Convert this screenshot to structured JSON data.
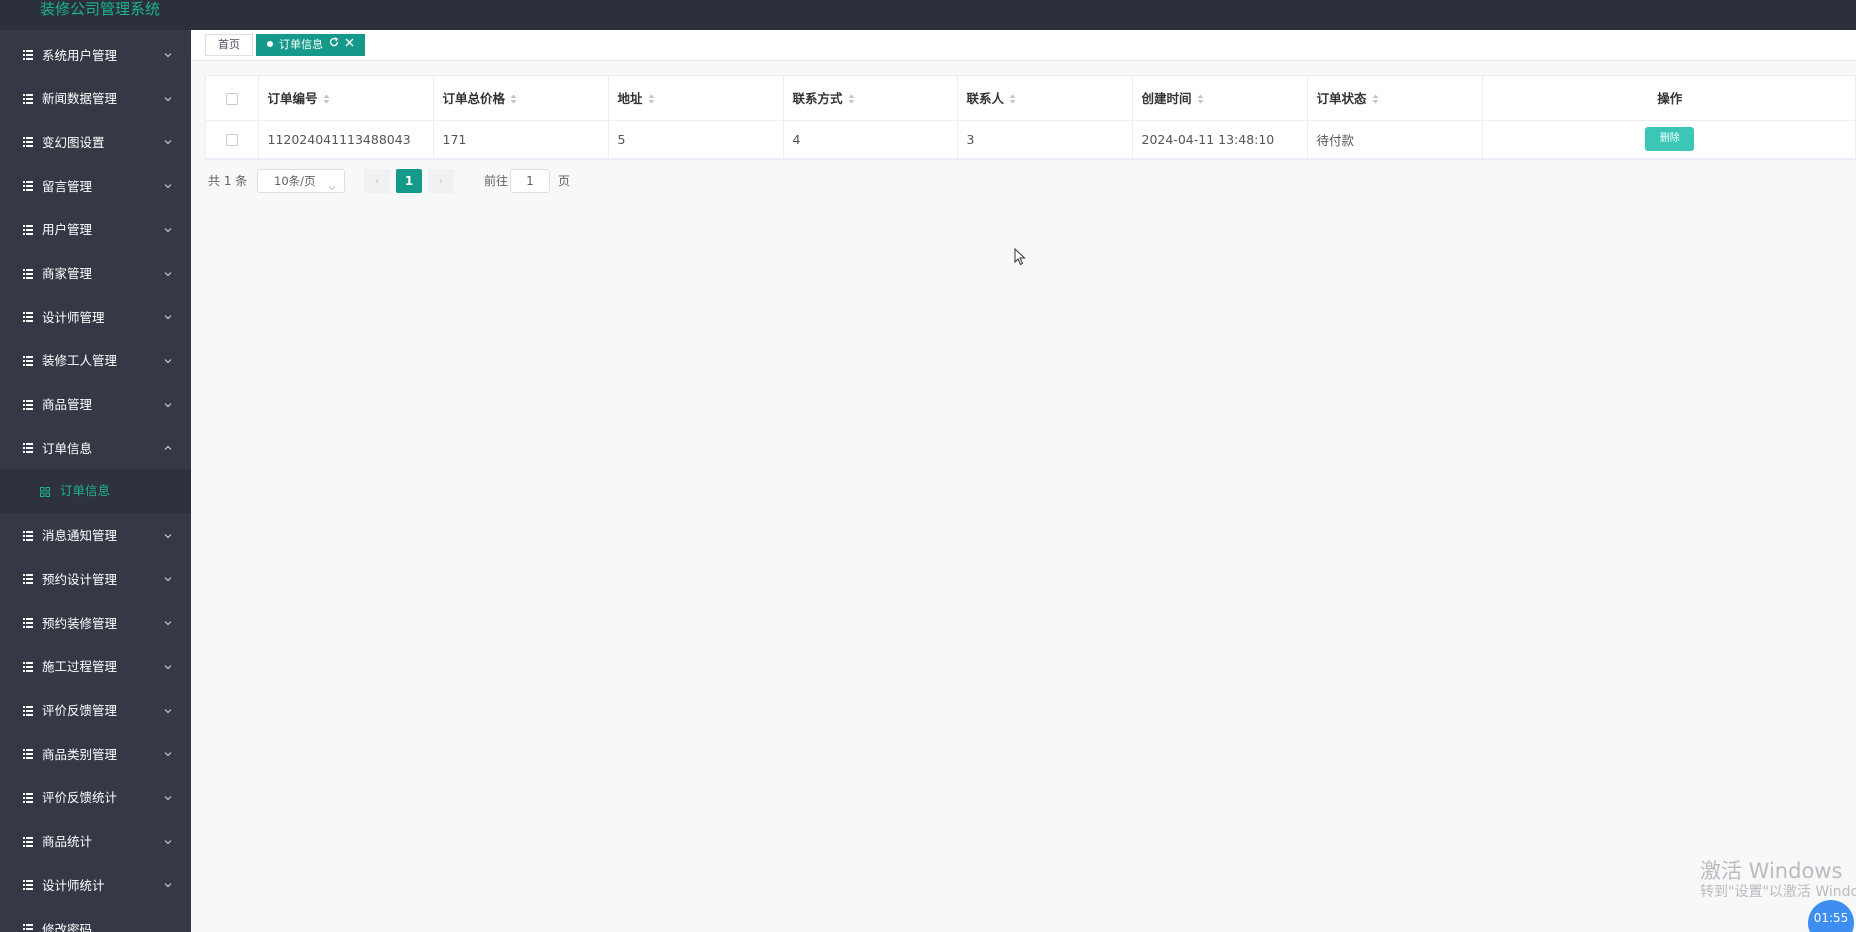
{
  "app": {
    "title": "装修公司管理系统"
  },
  "sidebar": {
    "items": [
      {
        "label": "系统用户管理"
      },
      {
        "label": "新闻数据管理"
      },
      {
        "label": "变幻图设置"
      },
      {
        "label": "留言管理"
      },
      {
        "label": "用户管理"
      },
      {
        "label": "商家管理"
      },
      {
        "label": "设计师管理"
      },
      {
        "label": "装修工人管理"
      },
      {
        "label": "商品管理"
      },
      {
        "label": "订单信息",
        "expanded": true
      },
      {
        "label": "消息通知管理"
      },
      {
        "label": "预约设计管理"
      },
      {
        "label": "预约装修管理"
      },
      {
        "label": "施工过程管理"
      },
      {
        "label": "评价反馈管理"
      },
      {
        "label": "商品类别管理"
      },
      {
        "label": "评价反馈统计"
      },
      {
        "label": "商品统计"
      },
      {
        "label": "设计师统计"
      },
      {
        "label": "修改密码"
      }
    ],
    "sub_item": {
      "label": "订单信息"
    }
  },
  "tabs": {
    "home": "首页",
    "active": "订单信息"
  },
  "table": {
    "columns": [
      "订单编号",
      "订单总价格",
      "地址",
      "联系方式",
      "联系人",
      "创建时间",
      "订单状态"
    ],
    "action_header": "操作",
    "rows": [
      {
        "order_no": "112024041113488043",
        "total": "171",
        "address": "5",
        "contact_method": "4",
        "contact_person": "3",
        "created": "2024-04-11 13:48:10",
        "status": "待付款",
        "action": "删除"
      }
    ]
  },
  "pagination": {
    "total": "共 1 条",
    "page_size": "10条/页",
    "current_page": "1",
    "goto_label": "前往",
    "goto_value": "1",
    "page_unit": "页",
    "prev": "‹",
    "next": "›"
  },
  "watermark": {
    "title": "激活 Windows",
    "subtitle": "转到\"设置\"以激活 Windows。"
  },
  "clock": "01:55",
  "colors": {
    "accent": "#14998a",
    "brand_text": "#1ab394",
    "sidebar_bg": "#343945",
    "topbar_bg": "#2c303a",
    "delete_button": "#3cc6b7"
  }
}
